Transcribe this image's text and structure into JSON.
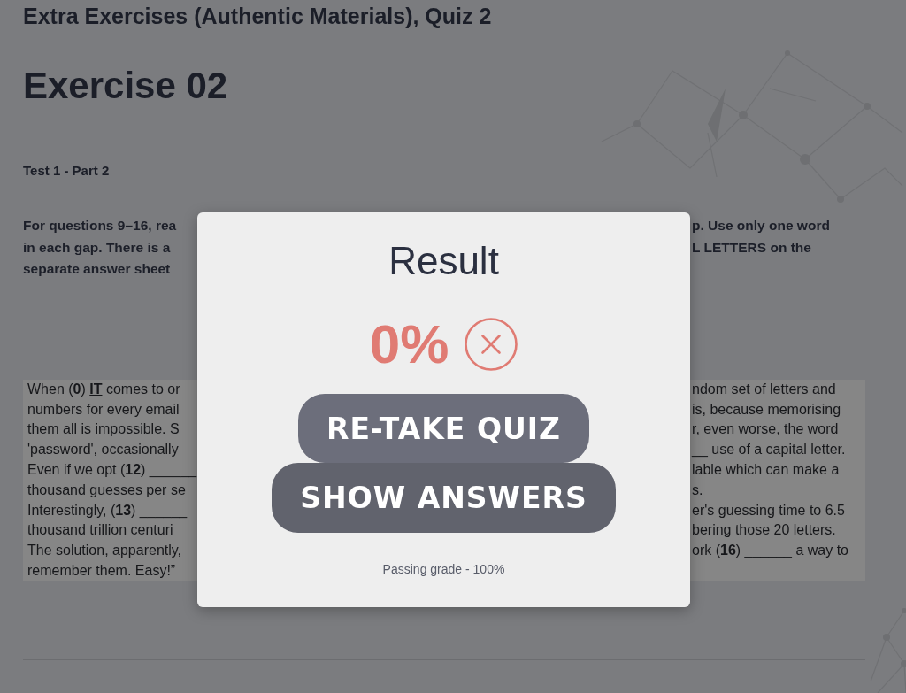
{
  "page": {
    "course_title": "Extra Exercises (Authentic Materials), Quiz 2",
    "exercise_title": "Exercise 02",
    "section_label": "Test 1 - Part 2",
    "instructions": [
      {
        "left": "For questions 9–16, rea",
        "right": "p. Use only one word"
      },
      {
        "left": "in each gap. There is a",
        "right": "L LETTERS on the"
      },
      {
        "left": "separate answer sheet"
      }
    ],
    "passage": [
      {
        "left": [
          {
            "kind": "plain",
            "text": "When (**0**) "
          },
          {
            "kind": "answer",
            "text": "IT"
          },
          {
            "kind": "plain",
            "text": " comes to or"
          }
        ],
        "right": [
          {
            "kind": "plain",
            "text": "ndom set of letters and"
          }
        ]
      },
      {
        "left": [
          {
            "kind": "plain",
            "text": "numbers for every email"
          }
        ],
        "right": [
          {
            "kind": "plain",
            "text": "is, because memorising"
          }
        ]
      },
      {
        "left": [
          {
            "kind": "plain",
            "text": "them all is impossible. "
          },
          {
            "kind": "link",
            "text": "S"
          }
        ],
        "right": [
          {
            "kind": "plain",
            "text": "r, even worse, the word"
          }
        ]
      },
      {
        "left": [
          {
            "kind": "plain",
            "text": "'password', occasionally"
          }
        ],
        "right": [
          {
            "kind": "plain",
            "text": "__ use of a capital letter."
          }
        ]
      },
      {
        "left": [
          {
            "kind": "plain",
            "text": "Even if we opt (**12**) ______"
          }
        ],
        "right": [
          {
            "kind": "plain",
            "text": "lable which can make a"
          }
        ]
      },
      {
        "left": [
          {
            "kind": "plain",
            "text": "thousand guesses per se"
          }
        ],
        "right": [
          {
            "kind": "plain",
            "text": "s."
          }
        ]
      },
      {
        "left": [
          {
            "kind": "plain",
            "text": "Interestingly, (**13**) ______"
          }
        ],
        "right": [
          {
            "kind": "plain",
            "text": "er's guessing time to 6.5"
          }
        ]
      },
      {
        "left": [
          {
            "kind": "plain",
            "text": "thousand trillion centuri"
          }
        ],
        "right": [
          {
            "kind": "plain",
            "text": "bering those 20 letters."
          }
        ]
      },
      {
        "left": [
          {
            "kind": "plain",
            "text": "The solution, apparently,"
          }
        ],
        "right": [
          {
            "kind": "plain",
            "text": "ork (**16**) ______ a way to"
          }
        ]
      },
      {
        "left": [
          {
            "kind": "plain",
            "text": "remember them. Easy!”"
          }
        ]
      }
    ]
  },
  "result_dialog": {
    "title": "Result",
    "score": "0%",
    "passed": false,
    "buttons": [
      {
        "kind": "retake",
        "label": "RE-TAKE QUIZ"
      },
      {
        "kind": "answers",
        "label": "SHOW ANSWERS"
      }
    ],
    "passing_grade": "Passing grade - 100%"
  }
}
